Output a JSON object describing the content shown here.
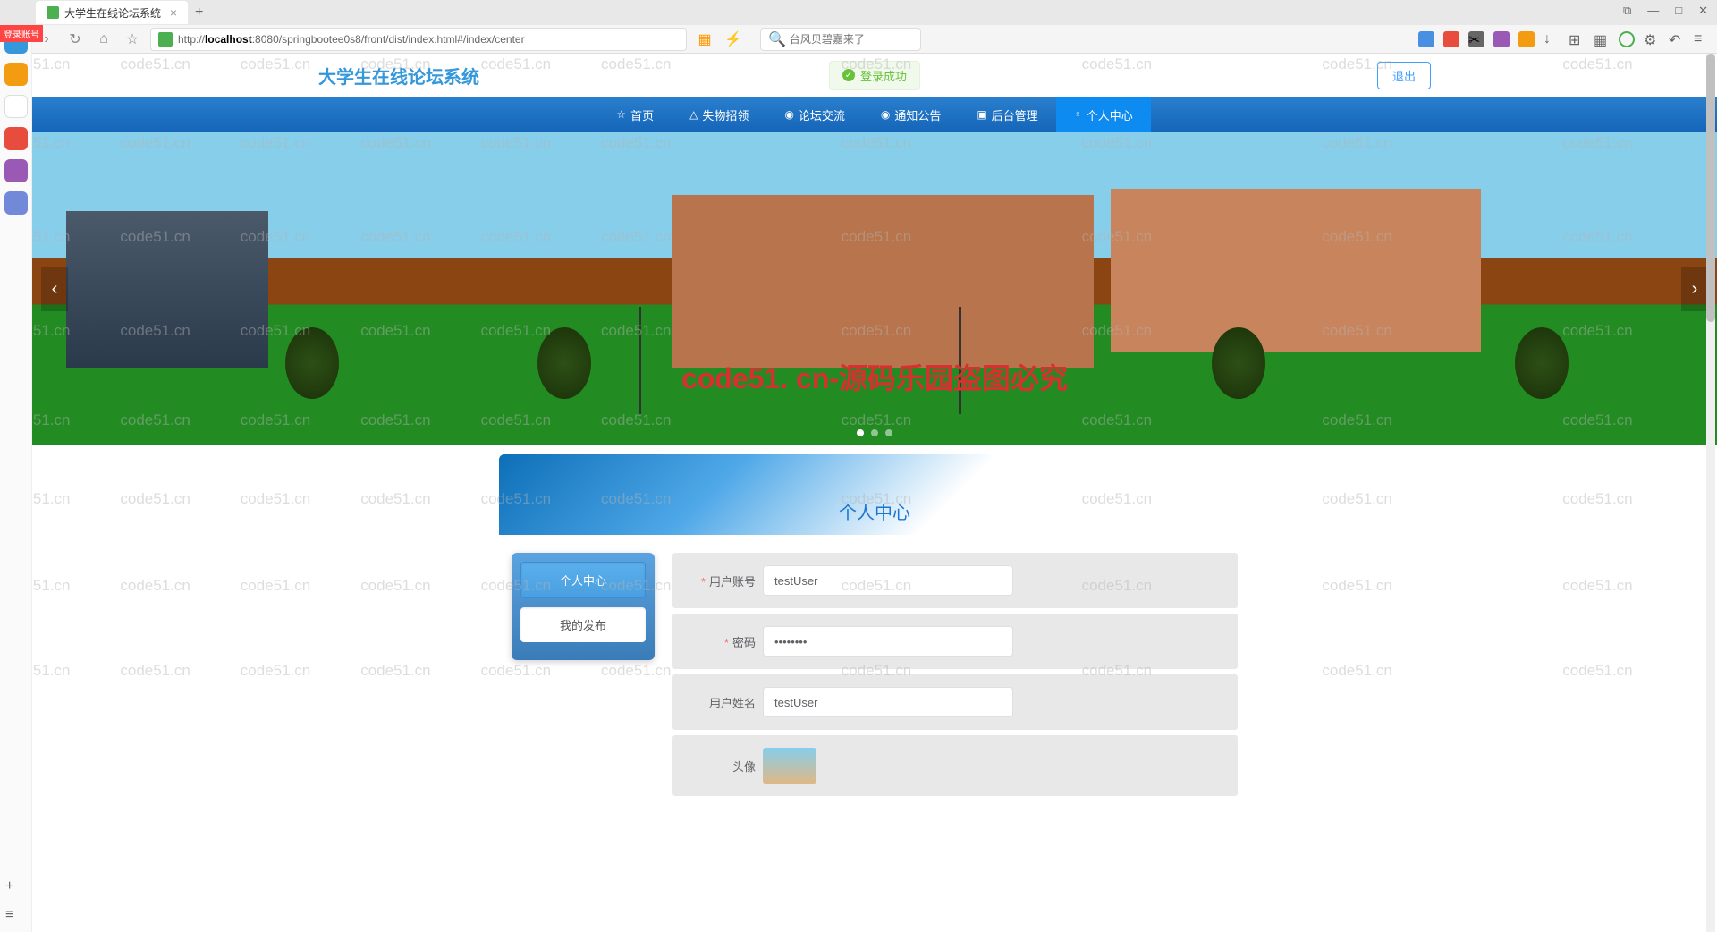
{
  "browser": {
    "tab_title": "大学生在线论坛系统",
    "url_prefix": "http://",
    "url_host": "localhost",
    "url_path": ":8080/springbootee0s8/front/dist/index.html#/index/center",
    "search_placeholder": "台风贝碧嘉来了",
    "login_badge": "登录账号"
  },
  "win_controls": {
    "min": "—",
    "max": "□",
    "close": "✕",
    "tab_icon": "⧉"
  },
  "header": {
    "site_title": "大学生在线论坛系统",
    "success_msg": "登录成功",
    "logout": "退出"
  },
  "nav": [
    {
      "icon": "☆",
      "label": "首页"
    },
    {
      "icon": "△",
      "label": "失物招领"
    },
    {
      "icon": "◉",
      "label": "论坛交流"
    },
    {
      "icon": "◉",
      "label": "通知公告"
    },
    {
      "icon": "▣",
      "label": "后台管理"
    },
    {
      "icon": "♀",
      "label": "个人中心",
      "active": true
    }
  ],
  "carousel": {
    "watermark_red": "code51. cn-源码乐园盗图必究"
  },
  "card": {
    "title": "个人中心",
    "menu": [
      {
        "label": "个人中心",
        "active": true
      },
      {
        "label": "我的发布",
        "active": false
      }
    ],
    "form": [
      {
        "label": "用户账号",
        "value": "testUser",
        "required": true,
        "type": "text"
      },
      {
        "label": "密码",
        "value": "••••••••",
        "required": true,
        "type": "password"
      },
      {
        "label": "用户姓名",
        "value": "testUser",
        "required": false,
        "type": "text"
      },
      {
        "label": "头像",
        "value": "",
        "required": false,
        "type": "avatar"
      }
    ]
  },
  "watermark": "code51.cn"
}
